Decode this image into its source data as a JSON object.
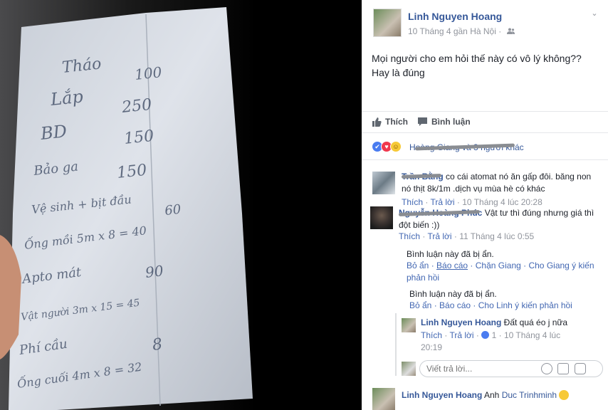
{
  "post": {
    "author": "Linh Nguyen Hoang",
    "meta": "10 Tháng 4 gần Hà Nội · ",
    "text": "Mọi người cho em hỏi thế này có vô lý không?? Hay là đúng"
  },
  "photo": {
    "lines": [
      "Tháo",
      "100",
      "Lắp",
      "250",
      "BD",
      "150",
      "Bảo ga",
      "150",
      "Vệ sinh + bịt đầu",
      "60",
      "Ống mồi 5m x 8 = 40",
      "Apto mát",
      "90",
      "Vật người 3m x 15 = 45",
      "Phí cầu",
      "8",
      "Ống cuối 4m x 8 = 32"
    ]
  },
  "actions": {
    "like": "Thích",
    "comment": "Bình luận"
  },
  "reactions": {
    "summary": "Hoàng Giang và 3 người khác"
  },
  "comments": [
    {
      "name": "Trần Bằng",
      "text": "co cái atomat nó ăn gấp đôi. băng non nó thịt 8k/1m .dịch vụ mùa hè có khác",
      "like": "Thích",
      "reply": "Trả lời",
      "time": "10 Tháng 4 lúc 20:28"
    },
    {
      "name": "Nguyễn Hoàng Phúc",
      "text": "Vật tư thì đúng nhưng giá thì đột biến :))",
      "like": "Thích",
      "reply": "Trả lời",
      "time": "11 Tháng 4 lúc 0:55"
    }
  ],
  "hidden": [
    {
      "note": "Bình luận này đã bị ẩn.",
      "unhide": "Bỏ ẩn",
      "report": "Báo cáo",
      "block": "Chặn Giang",
      "feedback": "Cho Giang ý kiến phản hồi"
    },
    {
      "note": "Bình luận này đã bị ẩn.",
      "unhide": "Bỏ ẩn",
      "report": "Báo cáo",
      "feedback": "Cho Linh ý kiến phản hồi"
    }
  ],
  "reply": {
    "name": "Linh Nguyen Hoang",
    "text": "Đất quá éo j nữa",
    "like": "Thích",
    "reply": "Trả lời",
    "count": "1",
    "time": "10 Tháng 4 lúc 20:19"
  },
  "reply_input": {
    "placeholder": "Viết trả lời..."
  },
  "last_comment": {
    "name": "Linh Nguyen Hoang",
    "prefix": "Anh",
    "mention": "Duc Trinhminh"
  },
  "icon_names": [
    "audience-icon",
    "chevron-down-icon",
    "like-icon",
    "comment-icon",
    "emoji-icon",
    "camera-icon",
    "sticker-icon",
    "sad-emoji-icon"
  ]
}
